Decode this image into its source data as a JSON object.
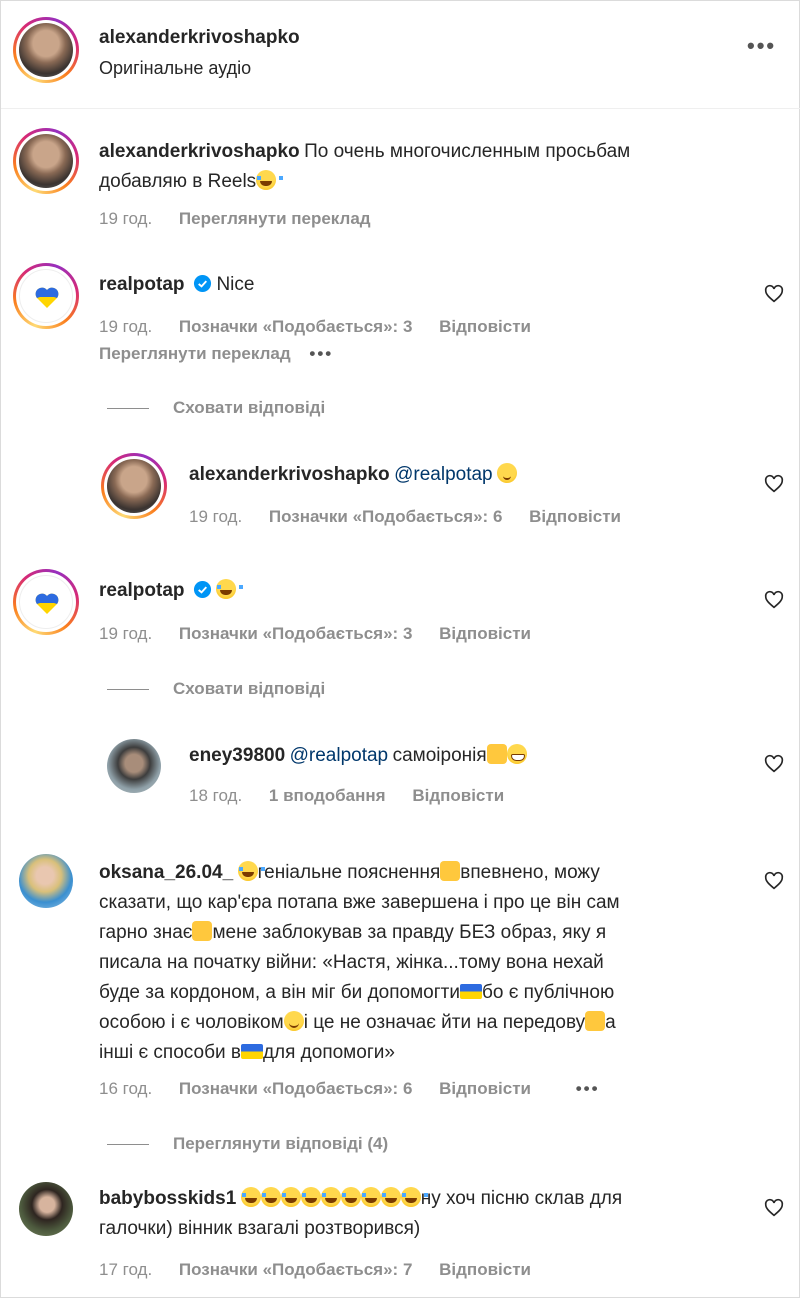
{
  "header": {
    "username": "alexanderkrivoshapko",
    "subtitle": "Оригінальне аудіо",
    "more_icon": "more-horizontal-icon"
  },
  "caption": {
    "username": "alexanderkrivoshapko",
    "text_line1": "По очень многочисленным просьбам",
    "text_line2": "добавляю в Reels",
    "time": "19 год.",
    "translate": "Переглянути переклад"
  },
  "comments": [
    {
      "username": "realpotap",
      "verified": true,
      "text": "Nice",
      "time": "19 год.",
      "likes": "Позначки «Подобається»: 3",
      "reply": "Відповісти",
      "translate": "Переглянути переклад",
      "toggle": "Сховати відповіді",
      "replies": [
        {
          "username": "alexanderkrivoshapko",
          "mention": "@realpotap",
          "time": "19 год.",
          "likes": "Позначки «Подобається»: 6",
          "reply": "Відповісти"
        }
      ]
    },
    {
      "username": "realpotap",
      "verified": true,
      "time": "19 год.",
      "likes": "Позначки «Подобається»: 3",
      "reply": "Відповісти",
      "toggle": "Сховати відповіді",
      "replies": [
        {
          "username": "eney39800",
          "mention": "@realpotap",
          "text": "самоіронія",
          "time": "18 год.",
          "likes": "1 вподобання",
          "reply": "Відповісти"
        }
      ]
    },
    {
      "username": "oksana_26.04_",
      "lines": [
        "геніальне пояснення",
        "впевнено, можу",
        "сказати, що кар'єра потапа вже завершена і про це він сам",
        "гарно знає",
        "мене заблокував за правду БЕЗ образ, яку я",
        "писала на початку війни: «Настя, жінка...тому вона нехай",
        "буде за кордоном, а він міг би допомогти",
        "бо є публічною",
        "особою і є чоловіком",
        "і це не означає йти на передову",
        "а",
        "інші є способи в",
        "для допомоги»"
      ],
      "time": "16 год.",
      "likes": "Позначки «Подобається»: 6",
      "reply": "Відповісти",
      "toggle": "Переглянути відповіді (4)"
    },
    {
      "username": "babybosskids1",
      "text_line1": "ну хоч пісню склав для",
      "text_line2": "галочки) вінник взагалі розтворився)",
      "time": "17 год.",
      "likes": "Позначки «Подобається»: 7",
      "reply": "Відповісти"
    }
  ],
  "colors": {
    "text": "#262626",
    "meta": "#8e8e8e",
    "mention": "#00376b",
    "verified": "#0095f6"
  },
  "icons": {
    "like": "heart-outline-icon",
    "verified": "verified-badge-icon",
    "more": "more-horizontal-icon"
  }
}
